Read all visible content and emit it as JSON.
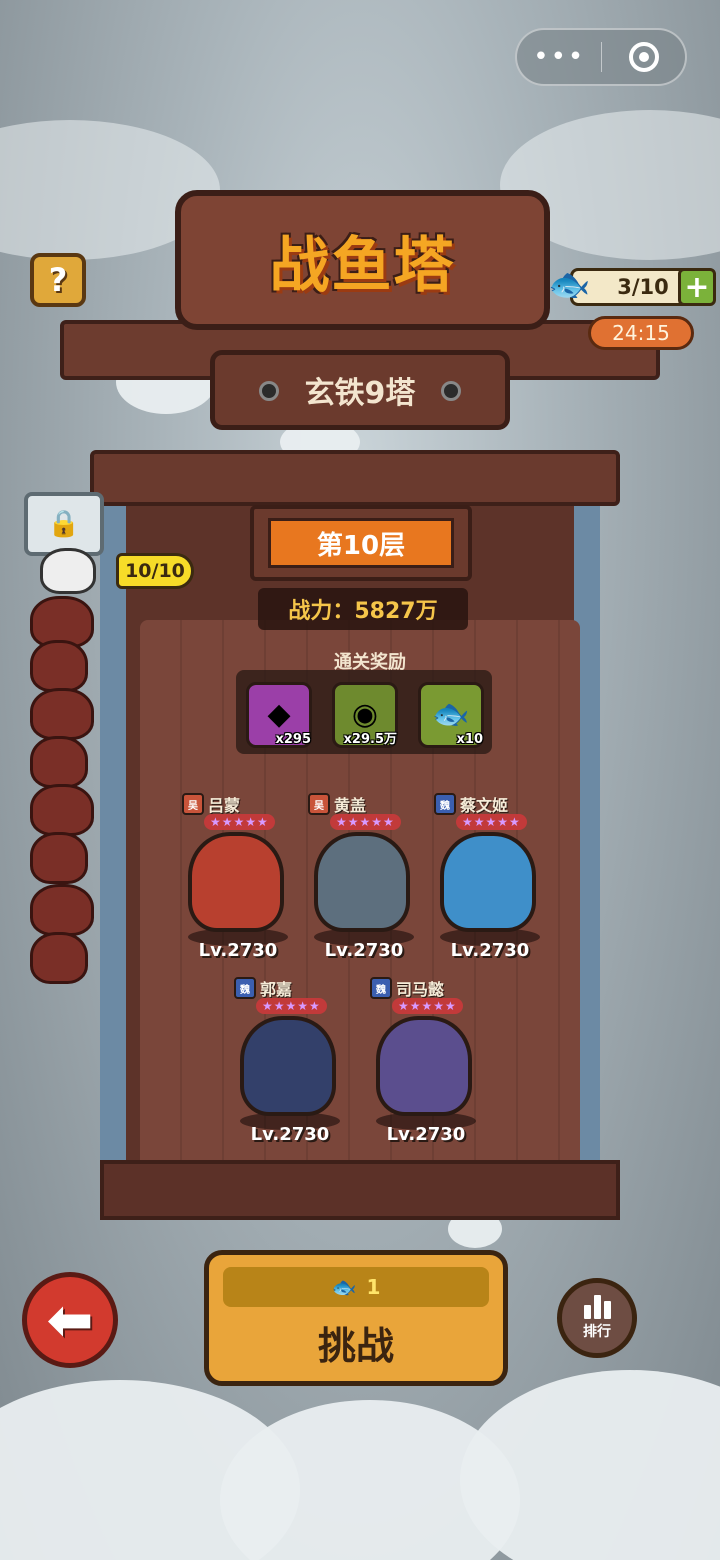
{
  "header": {
    "game_title": "战鱼塔",
    "tower_name": "玄铁9塔"
  },
  "capsule": {
    "more_icon": "•••",
    "close_icon": "target"
  },
  "help": {
    "label": "?"
  },
  "stamina": {
    "value": "3/10",
    "add_label": "+",
    "icon": "fish-coin-icon",
    "timer": "24:15"
  },
  "progress": {
    "label": "10/10"
  },
  "floor": {
    "label": "第10层",
    "power_label": "战力：5827万"
  },
  "rewards": {
    "title": "通关奖励",
    "items": [
      {
        "name": "crystal-shard",
        "icon": "crystal-icon",
        "count": "x295",
        "color": "#9b3fa8"
      },
      {
        "name": "copper-coin",
        "icon": "coin-icon",
        "count": "x29.5万",
        "color": "#6e8a2e"
      },
      {
        "name": "golden-fish",
        "icon": "fish-icon",
        "count": "x10",
        "color": "#7a9a32"
      }
    ]
  },
  "heroes": [
    {
      "name": "吕蒙",
      "faction": "吴",
      "faction_color": "#c9543a",
      "stars": "★★★★★",
      "level": "Lv.2730",
      "color": "#b8402f"
    },
    {
      "name": "黄盖",
      "faction": "吴",
      "faction_color": "#c9543a",
      "stars": "★★★★★",
      "level": "Lv.2730",
      "color": "#5d6f7e"
    },
    {
      "name": "蔡文姬",
      "faction": "魏",
      "faction_color": "#3b5fb0",
      "stars": "★★★★★",
      "level": "Lv.2730",
      "color": "#3f8fc9"
    },
    {
      "name": "郭嘉",
      "faction": "魏",
      "faction_color": "#3b5fb0",
      "stars": "★★★★★",
      "level": "Lv.2730",
      "color": "#33406a"
    },
    {
      "name": "司马懿",
      "faction": "魏",
      "faction_color": "#3b5fb0",
      "stars": "★★★★★",
      "level": "Lv.2730",
      "color": "#5b4e8e"
    }
  ],
  "bottom": {
    "back_icon": "⬅",
    "challenge_cost": "1",
    "challenge_label": "挑战",
    "rank_label": "排行"
  }
}
